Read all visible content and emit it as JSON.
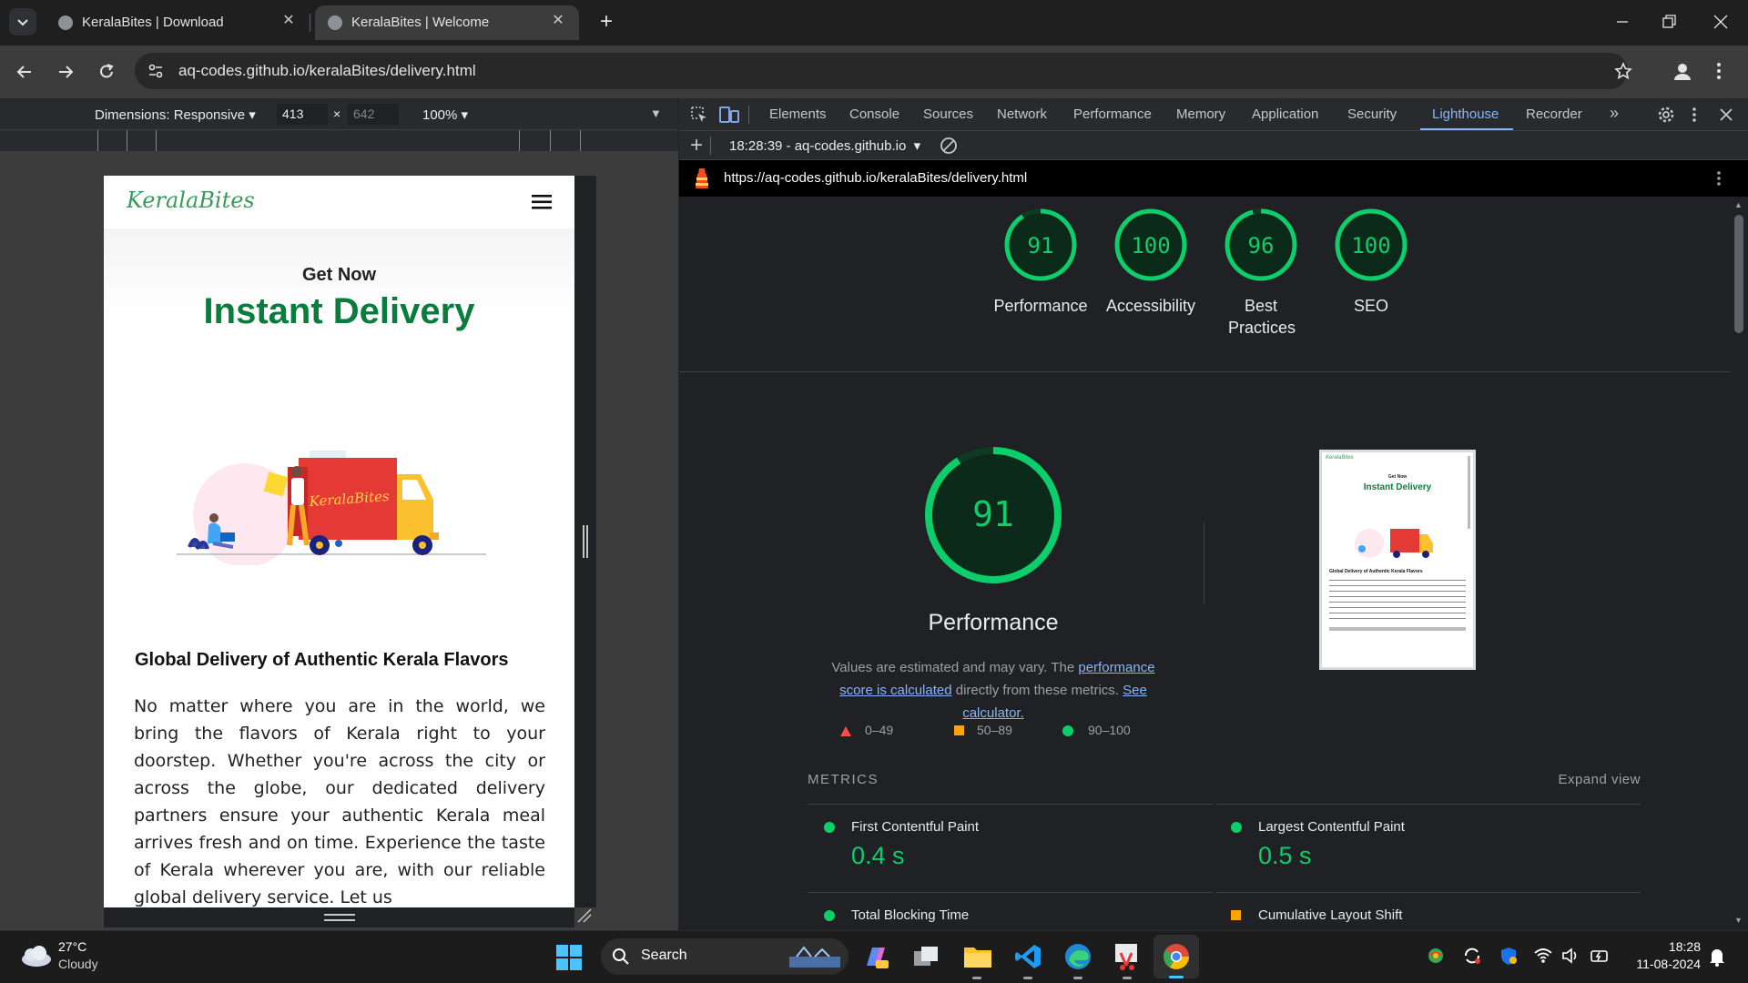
{
  "browser": {
    "tabs": [
      {
        "title": "KeralaBites | Download",
        "active": false
      },
      {
        "title": "KeralaBites | Welcome",
        "active": true
      }
    ],
    "url": "aq-codes.github.io/keralaBites/delivery.html"
  },
  "devicebar": {
    "dimensions_label": "Dimensions: Responsive",
    "width": "413",
    "height": "642",
    "zoom": "100%"
  },
  "devtools": {
    "tabs": [
      "Elements",
      "Console",
      "Sources",
      "Network",
      "Performance",
      "Memory",
      "Application",
      "Security",
      "Lighthouse",
      "Recorder"
    ],
    "active_tab": "Lighthouse",
    "report_select": "18:28:39 - aq-codes.github.io",
    "report_url": "https://aq-codes.github.io/keralaBites/delivery.html"
  },
  "lighthouse": {
    "scores": [
      {
        "value": "91",
        "label": "Performance"
      },
      {
        "value": "100",
        "label": "Accessibility"
      },
      {
        "value": "96",
        "label": "Best Practices"
      },
      {
        "value": "100",
        "label": "SEO"
      }
    ],
    "perf_score": "91",
    "perf_title": "Performance",
    "note_prefix": "Values are estimated and may vary. The ",
    "note_link1": "performance score is calculated",
    "note_mid": " directly from these metrics. ",
    "note_link2": "See calculator.",
    "legend": [
      "0–49",
      "50–89",
      "90–100"
    ],
    "metrics_heading": "METRICS",
    "expand_view": "Expand view",
    "metrics": [
      {
        "name": "First Contentful Paint",
        "value": "0.4 s",
        "status": "pass"
      },
      {
        "name": "Largest Contentful Paint",
        "value": "0.5 s",
        "status": "pass"
      },
      {
        "name": "Total Blocking Time",
        "value": "",
        "status": "pass"
      },
      {
        "name": "Cumulative Layout Shift",
        "value": "",
        "status": "average"
      }
    ],
    "thumb_title_small": "Get Now",
    "thumb_title": "Instant Delivery",
    "thumb_section": "Global Delivery of Authentic Kerala Flavors"
  },
  "page": {
    "logo": "KeralaBites",
    "kicker": "Get Now",
    "title": "Instant Delivery",
    "truck_label": "KeralaBites",
    "section_title": "Global Delivery of Authentic Kerala Flavors",
    "paragraph": "No matter where you are in the world, we bring the flavors of Kerala right to your doorstep. Whether you're across the city or across the globe, our dedicated delivery partners ensure your authentic Kerala meal arrives fresh and on time. Experience the taste of Kerala wherever you are, with our reliable global delivery service. Let us"
  },
  "taskbar": {
    "weather_temp": "27°C",
    "weather_desc": "Cloudy",
    "search_label": "Search",
    "time": "18:28",
    "date": "11-08-2024"
  },
  "colors": {
    "pass": "#0cce6b",
    "average": "#ffa400",
    "fail": "#ff4e42",
    "brand_green": "#0a7d3e",
    "link": "#8ab4f8"
  }
}
